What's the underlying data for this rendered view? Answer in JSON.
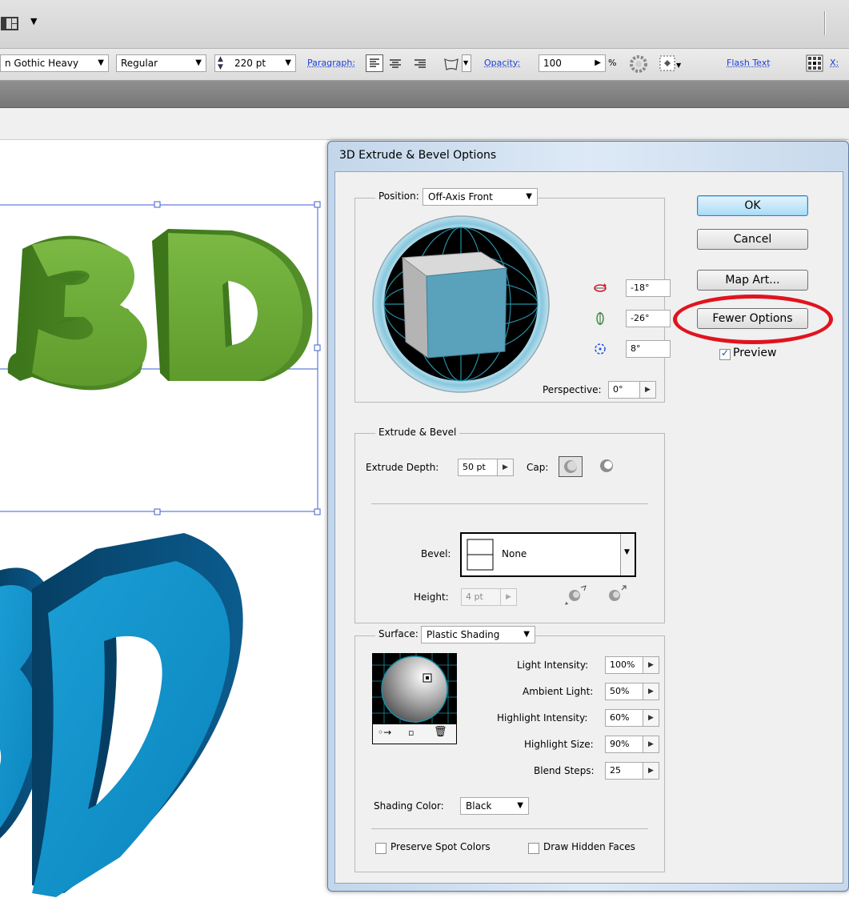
{
  "control_bar": {
    "font_family": "n Gothic Heavy",
    "font_style": "Regular",
    "font_size": "220 pt",
    "paragraph_label": "Paragraph:",
    "opacity_label": "Opacity:",
    "opacity_value": "100",
    "percent_sign": "%",
    "flash_text_label": "Flash Text",
    "x_label": "X:"
  },
  "artwork": {
    "green_text": "3D",
    "blue_text": "3D",
    "colors": {
      "green": "#6fab3a",
      "green_dark": "#3f7a1f",
      "blue": "#0e8bc4",
      "blue_dark": "#084e7c"
    }
  },
  "dialog": {
    "title": "3D Extrude & Bevel Options",
    "position": {
      "label": "Position:",
      "value": "Off-Axis Front",
      "x_rotation": "-18°",
      "y_rotation": "-26°",
      "z_rotation": "8°",
      "perspective_label": "Perspective:",
      "perspective_value": "0°"
    },
    "extrude": {
      "legend": "Extrude & Bevel",
      "depth_label": "Extrude Depth:",
      "depth_value": "50 pt",
      "cap_label": "Cap:",
      "bevel_label": "Bevel:",
      "bevel_value": "None",
      "height_label": "Height:",
      "height_value": "4 pt"
    },
    "surface": {
      "label": "Surface:",
      "value": "Plastic Shading",
      "light_intensity_label": "Light Intensity:",
      "light_intensity_value": "100%",
      "ambient_light_label": "Ambient Light:",
      "ambient_light_value": "50%",
      "highlight_intensity_label": "Highlight Intensity:",
      "highlight_intensity_value": "60%",
      "highlight_size_label": "Highlight Size:",
      "highlight_size_value": "90%",
      "blend_steps_label": "Blend Steps:",
      "blend_steps_value": "25",
      "shading_color_label": "Shading Color:",
      "shading_color_value": "Black"
    },
    "checkboxes": {
      "preserve_spot_colors": "Preserve Spot Colors",
      "draw_hidden_faces": "Draw Hidden Faces",
      "preview": "Preview"
    },
    "buttons": {
      "ok": "OK",
      "cancel": "Cancel",
      "map_art": "Map Art...",
      "fewer_options": "Fewer Options"
    },
    "cube_colors": {
      "front": "#5aa2bb",
      "top": "#d9d9d9",
      "side": "#b4b4b4"
    },
    "annotation_color": "#e0141e"
  }
}
